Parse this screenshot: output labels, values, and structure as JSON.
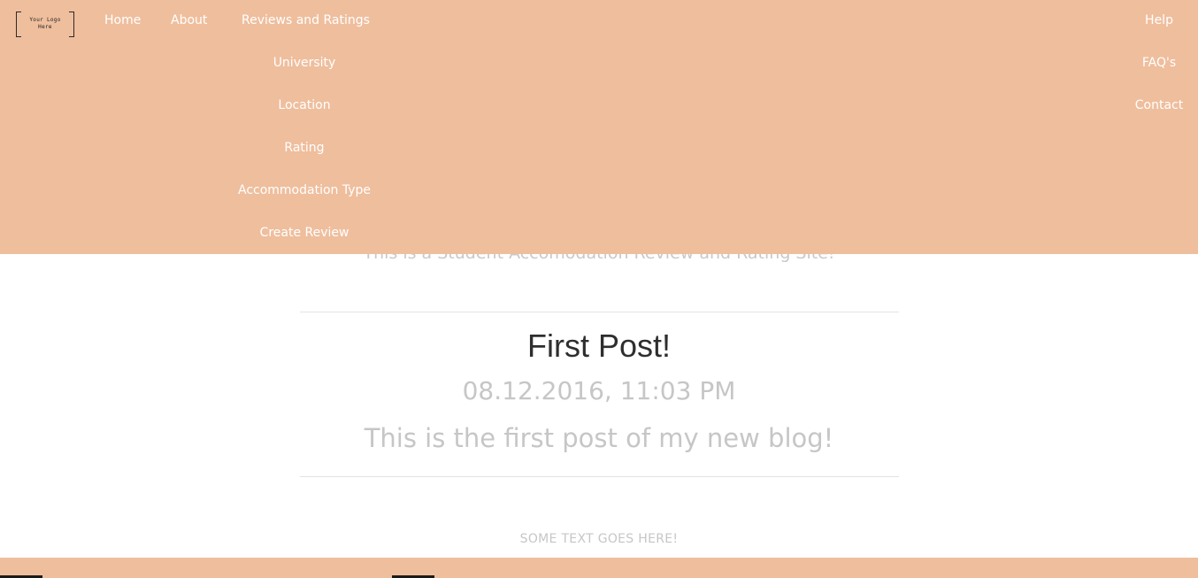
{
  "logo": {
    "line1": "Your Logo",
    "line2": "Here"
  },
  "nav": {
    "home": "Home",
    "about": "About",
    "reviews": "Reviews and Ratings",
    "reviews_items": [
      "University",
      "Location",
      "Rating",
      "Accommodation Type",
      "Create Review"
    ],
    "help": "Help",
    "help_items": [
      "FAQ's",
      "Contact"
    ]
  },
  "main": {
    "tagline": "This is a Student Accomodation Review and Rating Site!",
    "post_title": "First Post!",
    "post_date": "08.12.2016, 11:03 PM",
    "post_body": "This is the first post of my new blog!",
    "footer_text": "SOME TEXT GOES HERE!"
  },
  "colors": {
    "brand": "#efbe9d",
    "nav_text": "#ffffff",
    "muted_text": "#c6c6c6",
    "title_text": "#2e2e2e"
  }
}
